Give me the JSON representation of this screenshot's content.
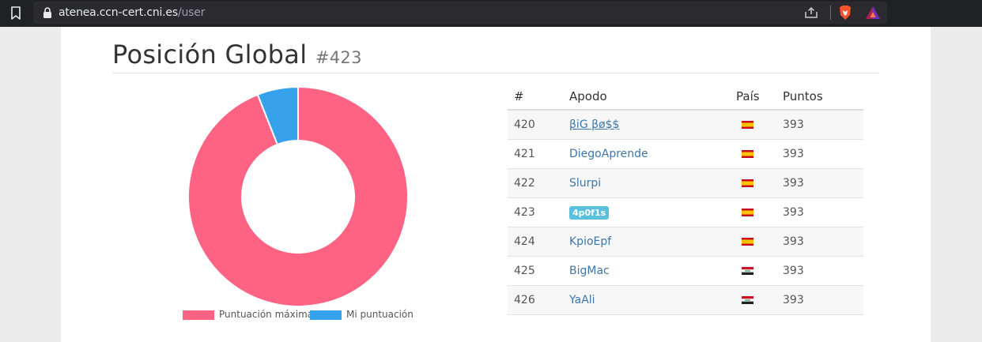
{
  "browser": {
    "url_host": "atenea.ccn-cert.cni.es",
    "url_path": "/user"
  },
  "header": {
    "title": "Posición Global",
    "rank": "#423"
  },
  "chart_data": {
    "type": "pie",
    "categories": [
      "Puntuación máxima",
      "Mi puntuación"
    ],
    "values": [
      94,
      6
    ],
    "colors": [
      "#ff6384",
      "#36a2eb"
    ],
    "legend_position": "bottom"
  },
  "table": {
    "headers": {
      "num": "#",
      "nick": "Apodo",
      "country": "País",
      "points": "Puntos"
    },
    "rows": [
      {
        "num": "420",
        "nick": "βiG βø$$",
        "style": "underlined",
        "flag": "spain",
        "points": "393"
      },
      {
        "num": "421",
        "nick": "DiegoAprende",
        "style": "link",
        "flag": "spain",
        "points": "393"
      },
      {
        "num": "422",
        "nick": "Slurpi",
        "style": "link",
        "flag": "spain",
        "points": "393"
      },
      {
        "num": "423",
        "nick": "4p0f1s",
        "style": "badge",
        "flag": "spain",
        "points": "393"
      },
      {
        "num": "424",
        "nick": "KpioEpf",
        "style": "link",
        "flag": "spain",
        "points": "393"
      },
      {
        "num": "425",
        "nick": "BigMac",
        "style": "link",
        "flag": "iraq",
        "points": "393"
      },
      {
        "num": "426",
        "nick": "YaAli",
        "style": "link",
        "flag": "iraq",
        "points": "393"
      }
    ]
  }
}
